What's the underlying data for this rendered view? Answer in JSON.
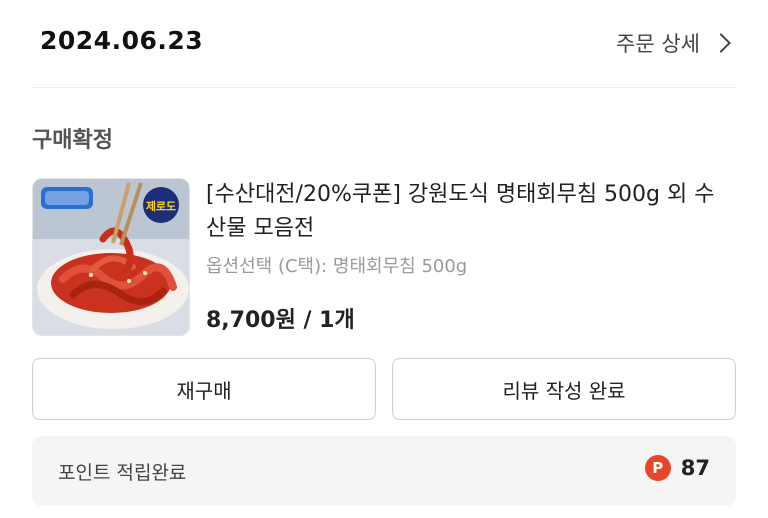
{
  "header": {
    "date": "2024.06.23",
    "detail_label": "주문 상세"
  },
  "status": "구매확정",
  "product": {
    "title": "[수산대전/20%쿠폰] 강원도식 명태회무침 500g 외 수산물 모음전",
    "option": "옵션선택 (C택): 명태회무침 500g",
    "price": "8,700원 / 1개",
    "thumb_badge": "제로도"
  },
  "buttons": {
    "rebuy": "재구매",
    "review": "리뷰 작성 완료"
  },
  "points": {
    "label": "포인트 적립완료",
    "icon_letter": "P",
    "value": "87"
  },
  "colors": {
    "point_icon": "#e8462a",
    "background": "#ffffff",
    "panel": "#f5f5f5"
  }
}
